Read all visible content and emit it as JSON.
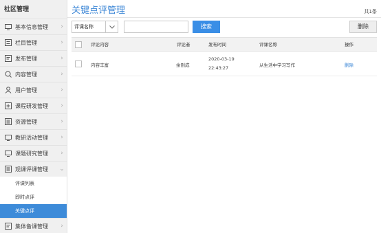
{
  "sidebar": {
    "title": "社区管理",
    "items": [
      {
        "label": "基本信息管理",
        "icon": "monitor-icon",
        "arrow": "›"
      },
      {
        "label": "栏目管理",
        "icon": "grid-icon",
        "arrow": "›"
      },
      {
        "label": "发布管理",
        "icon": "document-icon",
        "arrow": "›"
      },
      {
        "label": "内容管理",
        "icon": "search-icon",
        "arrow": "›"
      },
      {
        "label": "用户管理",
        "icon": "user-icon",
        "arrow": "›"
      },
      {
        "label": "课程研发管理",
        "icon": "edit-icon",
        "arrow": "›"
      },
      {
        "label": "资源管理",
        "icon": "list-icon",
        "arrow": "›"
      },
      {
        "label": "教研活动管理",
        "icon": "monitor-icon",
        "arrow": "›"
      },
      {
        "label": "课题研究管理",
        "icon": "monitor-icon",
        "arrow": "›"
      },
      {
        "label": "观课评课管理",
        "icon": "list-icon",
        "arrow": "⌄"
      }
    ],
    "subitems": [
      {
        "label": "评课列表"
      },
      {
        "label": "即时点评"
      },
      {
        "label": "关键点评"
      }
    ],
    "last_item": {
      "label": "集体备课管理",
      "icon": "document-icon",
      "arrow": "›"
    }
  },
  "main": {
    "title": "关键点评管理",
    "total": "共1条",
    "filter": {
      "selected": "评课名称",
      "input_value": "",
      "search_label": "搜索"
    },
    "delete_label": "删除",
    "columns": [
      "评论内容",
      "评论者",
      "发布时间",
      "评课名称",
      "操作"
    ],
    "rows": [
      {
        "content": "内容丰富",
        "author": "余则成",
        "date": "2020-03-19",
        "time": "22:43:27",
        "course": "从生活中学习写作",
        "action": "删除"
      }
    ]
  },
  "colors": {
    "accent": "#3b86d6",
    "active_bg": "#3d8bd9"
  }
}
